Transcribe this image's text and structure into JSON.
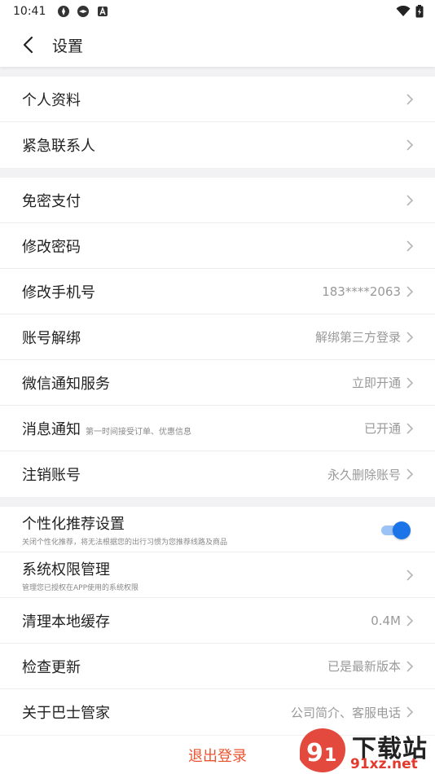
{
  "status_bar": {
    "time": "10:41"
  },
  "header": {
    "title": "设置"
  },
  "groups": [
    {
      "items": [
        {
          "label": "个人资料"
        },
        {
          "label": "紧急联系人"
        }
      ]
    },
    {
      "items": [
        {
          "label": "免密支付"
        },
        {
          "label": "修改密码"
        },
        {
          "label": "修改手机号",
          "value": "183****2063"
        },
        {
          "label": "账号解绑",
          "value": "解绑第三方登录"
        },
        {
          "label": "微信通知服务",
          "value": "立即开通"
        },
        {
          "label": "消息通知",
          "hint": "第一时间接受订单、优惠信息",
          "value": "已开通"
        },
        {
          "label": "注销账号",
          "value": "永久删除账号"
        }
      ]
    },
    {
      "items": [
        {
          "label": "个性化推荐设置",
          "sub": "关闭个性化推荐，将无法根据您的出行习惯为您推荐线路及商品",
          "toggle_on": true
        },
        {
          "label": "系统权限管理",
          "sub": "管理您已授权在APP使用的系统权限"
        },
        {
          "label": "清理本地缓存",
          "value": "0.4M"
        },
        {
          "label": "检查更新",
          "value": "已是最新版本"
        },
        {
          "label": "关于巴士管家",
          "value": "公司简介、客服电话"
        }
      ]
    }
  ],
  "logout_label": "退出登录",
  "watermark": {
    "top": "下载站",
    "bottom": "91xz.net"
  },
  "colors": {
    "accent": "#1c74e9",
    "logout": "#e9552f",
    "value_text": "#999999",
    "background": "#f2f2f4"
  }
}
